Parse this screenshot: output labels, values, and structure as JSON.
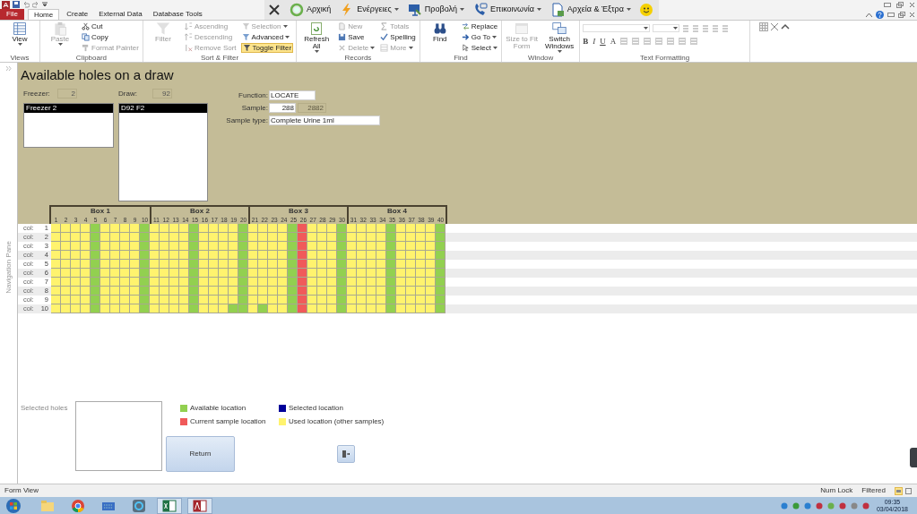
{
  "menu_tabs": [
    {
      "label": "File",
      "kind": "file",
      "selected": false
    },
    {
      "label": "Home",
      "kind": "tab",
      "selected": true
    },
    {
      "label": "Create",
      "kind": "tab",
      "selected": false
    },
    {
      "label": "External Data",
      "kind": "tab",
      "selected": false
    },
    {
      "label": "Database Tools",
      "kind": "tab",
      "selected": false
    }
  ],
  "custom_toolbar": [
    {
      "label": "Αρχική",
      "menu": false
    },
    {
      "label": "Ενέργειες",
      "menu": true
    },
    {
      "label": "Προβολή",
      "menu": true
    },
    {
      "label": "Επικοινωνία",
      "menu": true
    },
    {
      "label": "Αρχεία & Έξτρα",
      "menu": true
    }
  ],
  "ribbon_groups": [
    {
      "label": "Views",
      "kind": "standard",
      "items": [
        {
          "label": "View",
          "kind": "large",
          "disabled": false,
          "on": false,
          "dropdown": true
        }
      ]
    },
    {
      "label": "Clipboard",
      "kind": "standard",
      "items": [
        {
          "label": "Paste",
          "kind": "large",
          "disabled": true,
          "on": false,
          "dropdown": true
        },
        {
          "label": "Cut",
          "kind": "small",
          "disabled": false,
          "on": false,
          "dropdown": false
        },
        {
          "label": "Copy",
          "kind": "small",
          "disabled": false,
          "on": false,
          "dropdown": false
        },
        {
          "label": "Format Painter",
          "kind": "small",
          "disabled": true,
          "on": false,
          "dropdown": false
        }
      ]
    },
    {
      "label": "Sort & Filter",
      "kind": "standard",
      "items": [
        {
          "label": "Filter",
          "kind": "large",
          "disabled": true,
          "on": false,
          "dropdown": false
        },
        {
          "label": "Ascending",
          "kind": "small",
          "disabled": true,
          "on": false,
          "dropdown": false
        },
        {
          "label": "Descending",
          "kind": "small",
          "disabled": true,
          "on": false,
          "dropdown": false
        },
        {
          "label": "Remove Sort",
          "kind": "small",
          "disabled": true,
          "on": false,
          "dropdown": false
        },
        {
          "label": "Selection",
          "kind": "small",
          "disabled": true,
          "on": false,
          "dropdown": true
        },
        {
          "label": "Advanced",
          "kind": "small",
          "disabled": false,
          "on": false,
          "dropdown": true
        },
        {
          "label": "Toggle Filter",
          "kind": "small",
          "disabled": false,
          "on": true,
          "dropdown": false
        }
      ]
    },
    {
      "label": "Records",
      "kind": "standard",
      "items": [
        {
          "label": "Refresh All",
          "kind": "large",
          "disabled": false,
          "on": false,
          "dropdown": true
        },
        {
          "label": "New",
          "kind": "small",
          "disabled": true,
          "on": false,
          "dropdown": false
        },
        {
          "label": "Save",
          "kind": "small",
          "disabled": false,
          "on": false,
          "dropdown": false
        },
        {
          "label": "Delete",
          "kind": "small",
          "disabled": true,
          "on": false,
          "dropdown": true
        },
        {
          "label": "Totals",
          "kind": "small",
          "disabled": true,
          "on": false,
          "dropdown": false
        },
        {
          "label": "Spelling",
          "kind": "small",
          "disabled": false,
          "on": false,
          "dropdown": false
        },
        {
          "label": "More",
          "kind": "small",
          "disabled": true,
          "on": false,
          "dropdown": true
        }
      ]
    },
    {
      "label": "Find",
      "kind": "standard",
      "items": [
        {
          "label": "Find",
          "kind": "large",
          "disabled": false,
          "on": false,
          "dropdown": false
        },
        {
          "label": "Replace",
          "kind": "small",
          "disabled": false,
          "on": false,
          "dropdown": false
        },
        {
          "label": "Go To",
          "kind": "small",
          "disabled": false,
          "on": false,
          "dropdown": true
        },
        {
          "label": "Select",
          "kind": "small",
          "disabled": false,
          "on": false,
          "dropdown": true
        }
      ]
    },
    {
      "label": "Window",
      "kind": "standard",
      "items": [
        {
          "label": "Size to Fit Form",
          "kind": "large",
          "disabled": true,
          "on": false,
          "dropdown": false
        },
        {
          "label": "Switch Windows",
          "kind": "large",
          "disabled": false,
          "on": false,
          "dropdown": true
        }
      ]
    },
    {
      "label": "Text Formatting",
      "kind": "format",
      "letters": [
        {
          "label": "B"
        },
        {
          "label": "I"
        },
        {
          "label": "U"
        },
        {
          "label": "A"
        }
      ]
    }
  ],
  "side_pane": {
    "label": "Navigation Pane"
  },
  "form": {
    "title": "Available holes on a draw",
    "freezer": {
      "label": "Freezer:",
      "value": "2",
      "list": [
        {
          "label": "Freezer 2",
          "selected": true
        }
      ]
    },
    "draw": {
      "label": "Draw:",
      "value": "92",
      "list": [
        {
          "label": "D92 F2",
          "selected": true
        }
      ]
    },
    "fields": [
      {
        "label": "Function:",
        "value": "LOCATE"
      },
      {
        "label": "Sample:",
        "value": "288",
        "extra": "2882"
      },
      {
        "label": "Sample type:",
        "value": "Complete Urine 1ml"
      }
    ],
    "grid": {
      "boxes": [
        {
          "label": "Box 1",
          "numbers": [
            "1",
            "2",
            "3",
            "4",
            "5",
            "6",
            "7",
            "8",
            "9",
            "10"
          ]
        },
        {
          "label": "Box 2",
          "numbers": [
            "11",
            "12",
            "13",
            "14",
            "15",
            "16",
            "17",
            "18",
            "19",
            "20"
          ]
        },
        {
          "label": "Box 3",
          "numbers": [
            "21",
            "22",
            "23",
            "24",
            "25",
            "26",
            "27",
            "28",
            "29",
            "30"
          ]
        },
        {
          "label": "Box 4",
          "numbers": [
            "31",
            "32",
            "33",
            "34",
            "35",
            "36",
            "37",
            "38",
            "39",
            "40"
          ]
        }
      ],
      "rows": [
        {
          "label": "col:",
          "number": "1",
          "cells": [
            {
              "kind": "used"
            },
            {
              "kind": "used"
            },
            {
              "kind": "used"
            },
            {
              "kind": "used"
            },
            {
              "kind": "free"
            },
            {
              "kind": "used"
            },
            {
              "kind": "used"
            },
            {
              "kind": "used"
            },
            {
              "kind": "used"
            },
            {
              "kind": "free"
            },
            {
              "kind": "used"
            },
            {
              "kind": "used"
            },
            {
              "kind": "used"
            },
            {
              "kind": "used"
            },
            {
              "kind": "free"
            },
            {
              "kind": "used"
            },
            {
              "kind": "used"
            },
            {
              "kind": "used"
            },
            {
              "kind": "used"
            },
            {
              "kind": "free"
            },
            {
              "kind": "used"
            },
            {
              "kind": "used"
            },
            {
              "kind": "used"
            },
            {
              "kind": "used"
            },
            {
              "kind": "free"
            },
            {
              "kind": "current"
            },
            {
              "kind": "used"
            },
            {
              "kind": "used"
            },
            {
              "kind": "used"
            },
            {
              "kind": "free"
            },
            {
              "kind": "used"
            },
            {
              "kind": "used"
            },
            {
              "kind": "used"
            },
            {
              "kind": "used"
            },
            {
              "kind": "free"
            },
            {
              "kind": "used"
            },
            {
              "kind": "used"
            },
            {
              "kind": "used"
            },
            {
              "kind": "used"
            },
            {
              "kind": "free"
            }
          ]
        },
        {
          "label": "col:",
          "number": "2",
          "cells": [
            {
              "kind": "used"
            },
            {
              "kind": "used"
            },
            {
              "kind": "used"
            },
            {
              "kind": "used"
            },
            {
              "kind": "free"
            },
            {
              "kind": "used"
            },
            {
              "kind": "used"
            },
            {
              "kind": "used"
            },
            {
              "kind": "used"
            },
            {
              "kind": "free"
            },
            {
              "kind": "used"
            },
            {
              "kind": "used"
            },
            {
              "kind": "used"
            },
            {
              "kind": "used"
            },
            {
              "kind": "free"
            },
            {
              "kind": "used"
            },
            {
              "kind": "used"
            },
            {
              "kind": "used"
            },
            {
              "kind": "used"
            },
            {
              "kind": "free"
            },
            {
              "kind": "used"
            },
            {
              "kind": "used"
            },
            {
              "kind": "used"
            },
            {
              "kind": "used"
            },
            {
              "kind": "free"
            },
            {
              "kind": "current"
            },
            {
              "kind": "used"
            },
            {
              "kind": "used"
            },
            {
              "kind": "used"
            },
            {
              "kind": "free"
            },
            {
              "kind": "used"
            },
            {
              "kind": "used"
            },
            {
              "kind": "used"
            },
            {
              "kind": "used"
            },
            {
              "kind": "free"
            },
            {
              "kind": "used"
            },
            {
              "kind": "used"
            },
            {
              "kind": "used"
            },
            {
              "kind": "used"
            },
            {
              "kind": "free"
            }
          ]
        },
        {
          "label": "col:",
          "number": "3",
          "cells": [
            {
              "kind": "used"
            },
            {
              "kind": "used"
            },
            {
              "kind": "used"
            },
            {
              "kind": "used"
            },
            {
              "kind": "free"
            },
            {
              "kind": "used"
            },
            {
              "kind": "used"
            },
            {
              "kind": "used"
            },
            {
              "kind": "used"
            },
            {
              "kind": "free"
            },
            {
              "kind": "used"
            },
            {
              "kind": "used"
            },
            {
              "kind": "used"
            },
            {
              "kind": "used"
            },
            {
              "kind": "free"
            },
            {
              "kind": "used"
            },
            {
              "kind": "used"
            },
            {
              "kind": "used"
            },
            {
              "kind": "used"
            },
            {
              "kind": "free"
            },
            {
              "kind": "used"
            },
            {
              "kind": "used"
            },
            {
              "kind": "used"
            },
            {
              "kind": "used"
            },
            {
              "kind": "free"
            },
            {
              "kind": "current"
            },
            {
              "kind": "used"
            },
            {
              "kind": "used"
            },
            {
              "kind": "used"
            },
            {
              "kind": "free"
            },
            {
              "kind": "used"
            },
            {
              "kind": "used"
            },
            {
              "kind": "used"
            },
            {
              "kind": "used"
            },
            {
              "kind": "free"
            },
            {
              "kind": "used"
            },
            {
              "kind": "used"
            },
            {
              "kind": "used"
            },
            {
              "kind": "used"
            },
            {
              "kind": "free"
            }
          ]
        },
        {
          "label": "col:",
          "number": "4",
          "cells": [
            {
              "kind": "used"
            },
            {
              "kind": "used"
            },
            {
              "kind": "used"
            },
            {
              "kind": "used"
            },
            {
              "kind": "free"
            },
            {
              "kind": "used"
            },
            {
              "kind": "used"
            },
            {
              "kind": "used"
            },
            {
              "kind": "used"
            },
            {
              "kind": "free"
            },
            {
              "kind": "used"
            },
            {
              "kind": "used"
            },
            {
              "kind": "used"
            },
            {
              "kind": "used"
            },
            {
              "kind": "free"
            },
            {
              "kind": "used"
            },
            {
              "kind": "used"
            },
            {
              "kind": "used"
            },
            {
              "kind": "used"
            },
            {
              "kind": "free"
            },
            {
              "kind": "used"
            },
            {
              "kind": "used"
            },
            {
              "kind": "used"
            },
            {
              "kind": "used"
            },
            {
              "kind": "free"
            },
            {
              "kind": "current"
            },
            {
              "kind": "used"
            },
            {
              "kind": "used"
            },
            {
              "kind": "used"
            },
            {
              "kind": "free"
            },
            {
              "kind": "used"
            },
            {
              "kind": "used"
            },
            {
              "kind": "used"
            },
            {
              "kind": "used"
            },
            {
              "kind": "free"
            },
            {
              "kind": "used"
            },
            {
              "kind": "used"
            },
            {
              "kind": "used"
            },
            {
              "kind": "used"
            },
            {
              "kind": "free"
            }
          ]
        },
        {
          "label": "col:",
          "number": "5",
          "cells": [
            {
              "kind": "used"
            },
            {
              "kind": "used"
            },
            {
              "kind": "used"
            },
            {
              "kind": "used"
            },
            {
              "kind": "free"
            },
            {
              "kind": "used"
            },
            {
              "kind": "used"
            },
            {
              "kind": "used"
            },
            {
              "kind": "used"
            },
            {
              "kind": "free"
            },
            {
              "kind": "used"
            },
            {
              "kind": "used"
            },
            {
              "kind": "used"
            },
            {
              "kind": "used"
            },
            {
              "kind": "free"
            },
            {
              "kind": "used"
            },
            {
              "kind": "used"
            },
            {
              "kind": "used"
            },
            {
              "kind": "used"
            },
            {
              "kind": "free"
            },
            {
              "kind": "used"
            },
            {
              "kind": "used"
            },
            {
              "kind": "used"
            },
            {
              "kind": "used"
            },
            {
              "kind": "free"
            },
            {
              "kind": "current"
            },
            {
              "kind": "used"
            },
            {
              "kind": "used"
            },
            {
              "kind": "used"
            },
            {
              "kind": "free"
            },
            {
              "kind": "used"
            },
            {
              "kind": "used"
            },
            {
              "kind": "used"
            },
            {
              "kind": "used"
            },
            {
              "kind": "free"
            },
            {
              "kind": "used"
            },
            {
              "kind": "used"
            },
            {
              "kind": "used"
            },
            {
              "kind": "used"
            },
            {
              "kind": "free"
            }
          ]
        },
        {
          "label": "col:",
          "number": "6",
          "cells": [
            {
              "kind": "used"
            },
            {
              "kind": "used"
            },
            {
              "kind": "used"
            },
            {
              "kind": "used"
            },
            {
              "kind": "free"
            },
            {
              "kind": "used"
            },
            {
              "kind": "used"
            },
            {
              "kind": "used"
            },
            {
              "kind": "used"
            },
            {
              "kind": "free"
            },
            {
              "kind": "used"
            },
            {
              "kind": "used"
            },
            {
              "kind": "used"
            },
            {
              "kind": "used"
            },
            {
              "kind": "free"
            },
            {
              "kind": "used"
            },
            {
              "kind": "used"
            },
            {
              "kind": "used"
            },
            {
              "kind": "used"
            },
            {
              "kind": "free"
            },
            {
              "kind": "used"
            },
            {
              "kind": "used"
            },
            {
              "kind": "used"
            },
            {
              "kind": "used"
            },
            {
              "kind": "free"
            },
            {
              "kind": "current"
            },
            {
              "kind": "used"
            },
            {
              "kind": "used"
            },
            {
              "kind": "used"
            },
            {
              "kind": "free"
            },
            {
              "kind": "used"
            },
            {
              "kind": "used"
            },
            {
              "kind": "used"
            },
            {
              "kind": "used"
            },
            {
              "kind": "free"
            },
            {
              "kind": "used"
            },
            {
              "kind": "used"
            },
            {
              "kind": "used"
            },
            {
              "kind": "used"
            },
            {
              "kind": "free"
            }
          ]
        },
        {
          "label": "col:",
          "number": "7",
          "cells": [
            {
              "kind": "used"
            },
            {
              "kind": "used"
            },
            {
              "kind": "used"
            },
            {
              "kind": "used"
            },
            {
              "kind": "free"
            },
            {
              "kind": "used"
            },
            {
              "kind": "used"
            },
            {
              "kind": "used"
            },
            {
              "kind": "used"
            },
            {
              "kind": "free"
            },
            {
              "kind": "used"
            },
            {
              "kind": "used"
            },
            {
              "kind": "used"
            },
            {
              "kind": "used"
            },
            {
              "kind": "free"
            },
            {
              "kind": "used"
            },
            {
              "kind": "used"
            },
            {
              "kind": "used"
            },
            {
              "kind": "used"
            },
            {
              "kind": "free"
            },
            {
              "kind": "used"
            },
            {
              "kind": "used"
            },
            {
              "kind": "used"
            },
            {
              "kind": "used"
            },
            {
              "kind": "free"
            },
            {
              "kind": "current"
            },
            {
              "kind": "used"
            },
            {
              "kind": "used"
            },
            {
              "kind": "used"
            },
            {
              "kind": "free"
            },
            {
              "kind": "used"
            },
            {
              "kind": "used"
            },
            {
              "kind": "used"
            },
            {
              "kind": "used"
            },
            {
              "kind": "free"
            },
            {
              "kind": "used"
            },
            {
              "kind": "used"
            },
            {
              "kind": "used"
            },
            {
              "kind": "used"
            },
            {
              "kind": "free"
            }
          ]
        },
        {
          "label": "col:",
          "number": "8",
          "cells": [
            {
              "kind": "used"
            },
            {
              "kind": "used"
            },
            {
              "kind": "used"
            },
            {
              "kind": "used"
            },
            {
              "kind": "free"
            },
            {
              "kind": "used"
            },
            {
              "kind": "used"
            },
            {
              "kind": "used"
            },
            {
              "kind": "used"
            },
            {
              "kind": "free"
            },
            {
              "kind": "used"
            },
            {
              "kind": "used"
            },
            {
              "kind": "used"
            },
            {
              "kind": "used"
            },
            {
              "kind": "free"
            },
            {
              "kind": "used"
            },
            {
              "kind": "used"
            },
            {
              "kind": "used"
            },
            {
              "kind": "used"
            },
            {
              "kind": "free"
            },
            {
              "kind": "used"
            },
            {
              "kind": "used"
            },
            {
              "kind": "used"
            },
            {
              "kind": "used"
            },
            {
              "kind": "free"
            },
            {
              "kind": "current"
            },
            {
              "kind": "used"
            },
            {
              "kind": "used"
            },
            {
              "kind": "used"
            },
            {
              "kind": "free"
            },
            {
              "kind": "used"
            },
            {
              "kind": "used"
            },
            {
              "kind": "used"
            },
            {
              "kind": "used"
            },
            {
              "kind": "free"
            },
            {
              "kind": "used"
            },
            {
              "kind": "used"
            },
            {
              "kind": "used"
            },
            {
              "kind": "used"
            },
            {
              "kind": "free"
            }
          ]
        },
        {
          "label": "col:",
          "number": "9",
          "cells": [
            {
              "kind": "used"
            },
            {
              "kind": "used"
            },
            {
              "kind": "used"
            },
            {
              "kind": "used"
            },
            {
              "kind": "free"
            },
            {
              "kind": "used"
            },
            {
              "kind": "used"
            },
            {
              "kind": "used"
            },
            {
              "kind": "used"
            },
            {
              "kind": "free"
            },
            {
              "kind": "used"
            },
            {
              "kind": "used"
            },
            {
              "kind": "used"
            },
            {
              "kind": "used"
            },
            {
              "kind": "free"
            },
            {
              "kind": "used"
            },
            {
              "kind": "used"
            },
            {
              "kind": "used"
            },
            {
              "kind": "used"
            },
            {
              "kind": "free"
            },
            {
              "kind": "used"
            },
            {
              "kind": "used"
            },
            {
              "kind": "used"
            },
            {
              "kind": "used"
            },
            {
              "kind": "free"
            },
            {
              "kind": "current"
            },
            {
              "kind": "used"
            },
            {
              "kind": "used"
            },
            {
              "kind": "used"
            },
            {
              "kind": "free"
            },
            {
              "kind": "used"
            },
            {
              "kind": "used"
            },
            {
              "kind": "used"
            },
            {
              "kind": "used"
            },
            {
              "kind": "free"
            },
            {
              "kind": "used"
            },
            {
              "kind": "used"
            },
            {
              "kind": "used"
            },
            {
              "kind": "used"
            },
            {
              "kind": "free"
            }
          ]
        },
        {
          "label": "col:",
          "number": "10",
          "cells": [
            {
              "kind": "used"
            },
            {
              "kind": "used"
            },
            {
              "kind": "used"
            },
            {
              "kind": "used"
            },
            {
              "kind": "free"
            },
            {
              "kind": "used"
            },
            {
              "kind": "used"
            },
            {
              "kind": "used"
            },
            {
              "kind": "used"
            },
            {
              "kind": "free"
            },
            {
              "kind": "used"
            },
            {
              "kind": "used"
            },
            {
              "kind": "used"
            },
            {
              "kind": "used"
            },
            {
              "kind": "free"
            },
            {
              "kind": "used"
            },
            {
              "kind": "used"
            },
            {
              "kind": "used"
            },
            {
              "kind": "free"
            },
            {
              "kind": "free"
            },
            {
              "kind": "used"
            },
            {
              "kind": "free"
            },
            {
              "kind": "used"
            },
            {
              "kind": "used"
            },
            {
              "kind": "free"
            },
            {
              "kind": "current"
            },
            {
              "kind": "used"
            },
            {
              "kind": "used"
            },
            {
              "kind": "used"
            },
            {
              "kind": "free"
            },
            {
              "kind": "used"
            },
            {
              "kind": "used"
            },
            {
              "kind": "used"
            },
            {
              "kind": "used"
            },
            {
              "kind": "free"
            },
            {
              "kind": "used"
            },
            {
              "kind": "used"
            },
            {
              "kind": "used"
            },
            {
              "kind": "used"
            },
            {
              "kind": "free"
            }
          ]
        }
      ]
    },
    "selected_holes": {
      "label": "Selected holes"
    },
    "legend": [
      {
        "label": "Available location",
        "kind": "free",
        "color": "#92d050"
      },
      {
        "label": "Selected location",
        "kind": "selected",
        "color": "#000099"
      },
      {
        "label": "Current sample location",
        "kind": "current",
        "color": "#f05a5a"
      },
      {
        "label": "Used location (other samples)",
        "kind": "used",
        "color": "#fff36e"
      }
    ],
    "return_button": {
      "label": "Return"
    }
  },
  "status_bar": {
    "left": "Form View",
    "indicators": [
      "Num Lock",
      "Filtered"
    ]
  },
  "taskbar": {
    "apps": [
      {
        "active": false
      },
      {
        "active": false
      },
      {
        "active": false
      },
      {
        "active": false
      },
      {
        "active": true
      },
      {
        "active": true
      }
    ],
    "time": "09:35",
    "date": "03/04/2018"
  }
}
